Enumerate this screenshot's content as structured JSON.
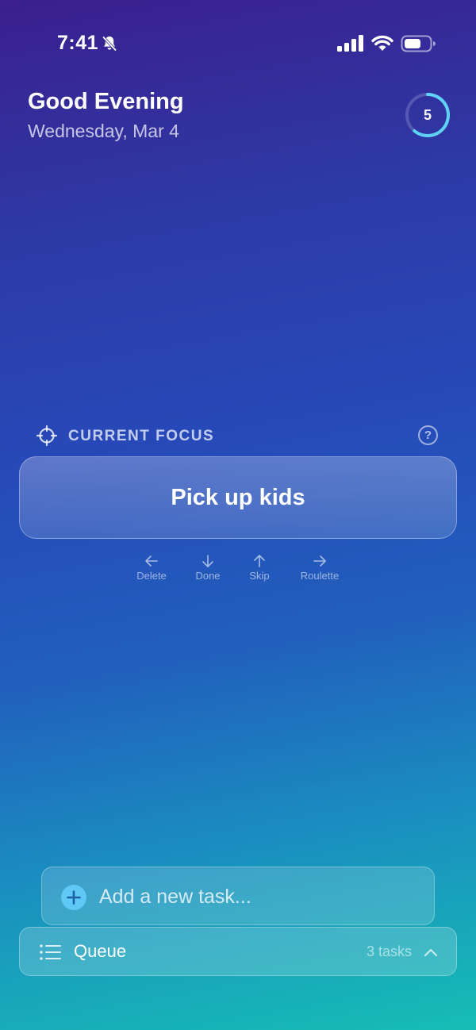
{
  "status": {
    "time": "7:41"
  },
  "header": {
    "greeting": "Good Evening",
    "date": "Wednesday, Mar 4",
    "streak_count": "5"
  },
  "focus": {
    "label": "CURRENT FOCUS",
    "help_symbol": "?",
    "task": "Pick up kids"
  },
  "gestures": [
    {
      "label": "Delete",
      "icon": "arrow-left-icon"
    },
    {
      "label": "Done",
      "icon": "arrow-down-icon"
    },
    {
      "label": "Skip",
      "icon": "arrow-up-icon"
    },
    {
      "label": "Roulette",
      "icon": "arrow-right-icon"
    }
  ],
  "add_task": {
    "placeholder": "Add a new task..."
  },
  "queue": {
    "label": "Queue",
    "count": "3 tasks"
  },
  "colors": {
    "ring_accent": "#5fd3f5",
    "plus_icon": "#5fc8f5"
  }
}
